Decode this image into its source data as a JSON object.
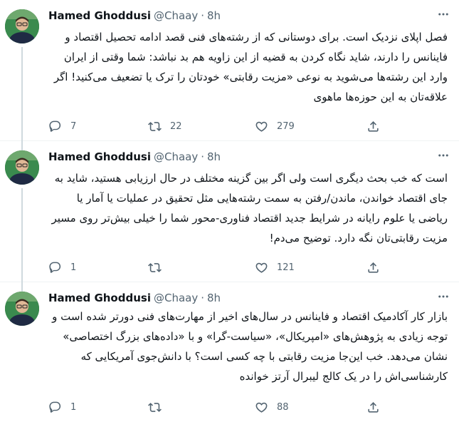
{
  "tweets": [
    {
      "author": "Hamed Ghoddusi",
      "handle": "@Chaay",
      "separator": "·",
      "time": "8h",
      "text": "فصل اپلای نزدیک است. برای دوستانی که از رشته‌های فنی قصد ادامه تحصیل اقتصاد و فاینانس را دارند، شاید نگاه کردن به قضیه از این زاویه هم بد نباشد: شما وقتی از ایران وارد این رشته‌ها می‌شوید به نوعی «مزیت رقابتی» خودتان را ترک یا تضعیف می‌کنید! اگر علاقه‌تان به این حوزه‌ها ماهوی",
      "reply_count": "7",
      "retweet_count": "22",
      "like_count": "279"
    },
    {
      "author": "Hamed Ghoddusi",
      "handle": "@Chaay",
      "separator": "·",
      "time": "8h",
      "text": "است که خب بحث دیگری است ولی اگر بین گزینه مختلف در حال ارزیابی هستید، شاید به جای اقتصاد خواندن، ماندن/رفتن به سمت رشته‌هایی مثل تحقیق در عملیات یا آمار یا ریاضی یا علوم رایانه در شرایط جدید اقتصاد فناوری-محور شما را خیلی بیش‌تر روی مسیر مزیت رقابتی‌تان نگه دارد. توضیح می‌دم!",
      "reply_count": "1",
      "retweet_count": "",
      "like_count": "121"
    },
    {
      "author": "Hamed Ghoddusi",
      "handle": "@Chaay",
      "separator": "·",
      "time": "8h",
      "text": "بازار کار آکادمیک اقتصاد و فاینانس در سال‌های اخیر از مهارت‌های فنی دورتر شده است و توجه زیادی به پژوهش‌های «امپریکال»، «سیاست-گرا» و با «داده‌های بزرگ اختصاصی» نشان می‌دهد. خب این‌جا مزیت رقابتی با چه کسی است؟ با دانش‌جوی آمریکایی که کارشناسی‌اش را در یک کالج لیبرال آرتز خوانده",
      "reply_count": "1",
      "retweet_count": "",
      "like_count": "88"
    }
  ],
  "icons": {
    "reply": "reply-icon",
    "retweet": "retweet-icon",
    "like": "like-icon",
    "share": "share-icon",
    "more": "more-icon"
  },
  "colors": {
    "text": "#0f1419",
    "secondary": "#536471",
    "thread_line": "#cfd9de",
    "avatar_bg": "#2f7d43"
  }
}
